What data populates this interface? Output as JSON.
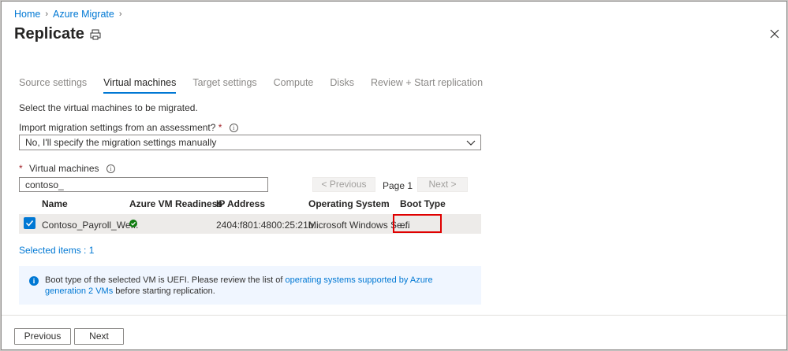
{
  "breadcrumb": {
    "items": [
      "Home",
      "Azure Migrate"
    ]
  },
  "page": {
    "title": "Replicate"
  },
  "tabs": [
    {
      "label": "Source settings"
    },
    {
      "label": "Virtual machines"
    },
    {
      "label": "Target settings"
    },
    {
      "label": "Compute"
    },
    {
      "label": "Disks"
    },
    {
      "label": "Review + Start replication"
    }
  ],
  "intro": "Select the virtual machines to be migrated.",
  "import_settings": {
    "label": "Import migration settings from an assessment?",
    "required_mark": "*",
    "selected": "No, I'll specify the migration settings manually"
  },
  "vm_section": {
    "required_mark": "*",
    "label": "Virtual machines"
  },
  "search": {
    "value": "contoso_"
  },
  "pager": {
    "previous": "< Previous",
    "page": "Page 1",
    "next": "Next >"
  },
  "table": {
    "headers": [
      "Name",
      "Azure VM Readiness",
      "IP Address",
      "Operating System",
      "Boot Type"
    ],
    "rows": [
      {
        "name": "Contoso_Payroll_We...",
        "ip": "2404:f801:4800:25:21b...",
        "os": "Microsoft Windows Se...",
        "boot": "efi"
      }
    ]
  },
  "selected_items": "Selected items : 1",
  "info": {
    "text_before": "Boot type of the selected VM is UEFI. Please review the list of ",
    "link": "operating systems supported by Azure generation 2 VMs",
    "text_after": " before starting replication."
  },
  "footer": {
    "previous": "Previous",
    "next": "Next"
  },
  "colors": {
    "accent": "#0078d4",
    "success": "#107c10",
    "highlight": "#e00000"
  }
}
